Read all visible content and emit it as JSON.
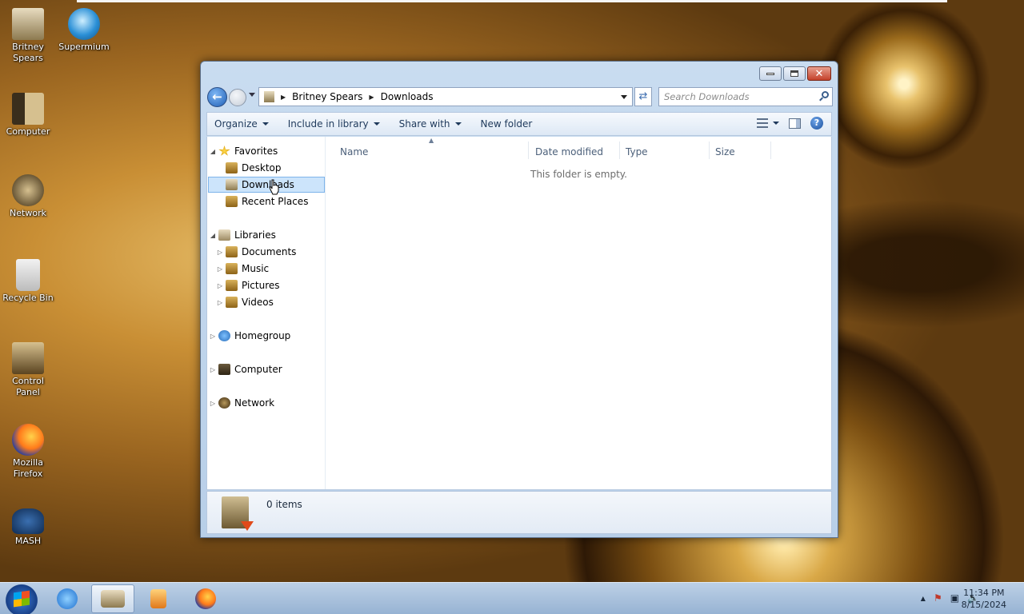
{
  "desktop": {
    "icons": [
      {
        "label": "Britney Spears",
        "icon": "user-folder-icon"
      },
      {
        "label": "Supermium",
        "icon": "browser-icon"
      },
      {
        "label": "Computer",
        "icon": "computer-icon"
      },
      {
        "label": "Network",
        "icon": "network-icon"
      },
      {
        "label": "Recycle Bin",
        "icon": "recycle-bin-icon"
      },
      {
        "label": "Control Panel",
        "icon": "control-panel-icon"
      },
      {
        "label": "Mozilla Firefox",
        "icon": "firefox-icon"
      },
      {
        "label": "MASH",
        "icon": "mash-icon"
      }
    ]
  },
  "window": {
    "address": {
      "root": "Britney Spears",
      "current": "Downloads"
    },
    "search_placeholder": "Search Downloads",
    "toolbar": {
      "organize": "Organize",
      "include_in_library": "Include in library",
      "share_with": "Share with",
      "new_folder": "New folder"
    },
    "nav": {
      "favorites": "Favorites",
      "desktop": "Desktop",
      "downloads": "Downloads",
      "recent_places": "Recent Places",
      "libraries": "Libraries",
      "documents": "Documents",
      "music": "Music",
      "pictures": "Pictures",
      "videos": "Videos",
      "homegroup": "Homegroup",
      "computer": "Computer",
      "network": "Network"
    },
    "columns": {
      "name": "Name",
      "date_modified": "Date modified",
      "type": "Type",
      "size": "Size"
    },
    "empty_message": "This folder is empty.",
    "status": {
      "items": "0 items"
    }
  },
  "taskbar": {
    "pinned": [
      "internet-explorer-icon",
      "explorer-icon",
      "media-player-icon",
      "firefox-icon"
    ],
    "clock": {
      "time": "11:34 PM",
      "date": "8/15/2024"
    }
  },
  "colors": {
    "selection": "#cce4fb",
    "selection_border": "#7eb4ea",
    "close_button": "#c4412b"
  }
}
